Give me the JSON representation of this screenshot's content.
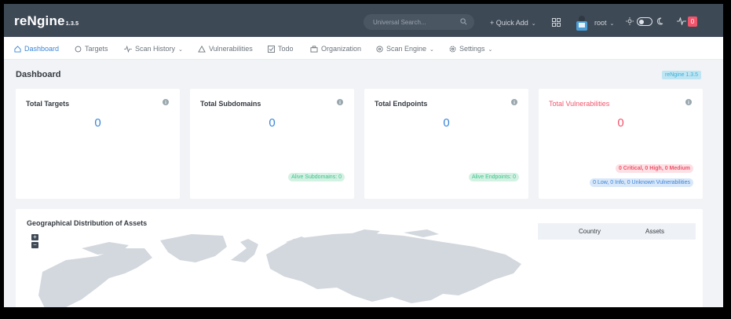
{
  "brand": {
    "name": "reNgine",
    "version": "1.3.5"
  },
  "topbar": {
    "search_placeholder": "Universal Search...",
    "quick_add": "+  Quick Add",
    "user": "root",
    "notifications": "0"
  },
  "nav": {
    "dashboard": "Dashboard",
    "targets": "Targets",
    "scan_history": "Scan History",
    "vulnerabilities": "Vulnerabilities",
    "todo": "Todo",
    "organization": "Organization",
    "scan_engine": "Scan Engine",
    "settings": "Settings"
  },
  "page": {
    "title": "Dashboard",
    "version_badge": "reNgine 1.3.5"
  },
  "cards": {
    "targets": {
      "title": "Total Targets",
      "value": "0"
    },
    "subdomains": {
      "title": "Total Subdomains",
      "value": "0",
      "alive": "Alive Subdomains: 0"
    },
    "endpoints": {
      "title": "Total Endpoints",
      "value": "0",
      "alive": "Alive Endpoints: 0"
    },
    "vulns": {
      "title": "Total Vulnerabilities",
      "value": "0",
      "severe": "0 Critical, 0 High, 0 Medium",
      "other": "0 Low, 0 Info, 0 Unknown Vulnerabilities"
    }
  },
  "geo": {
    "title": "Geographical Distribution of Assets",
    "zoom_in": "+",
    "zoom_out": "−",
    "columns": {
      "country": "Country",
      "assets": "Assets"
    }
  },
  "colors": {
    "topbar": "#3e4956",
    "accent": "#3b86d8",
    "danger": "#f1556c",
    "success": "#3cc389"
  }
}
